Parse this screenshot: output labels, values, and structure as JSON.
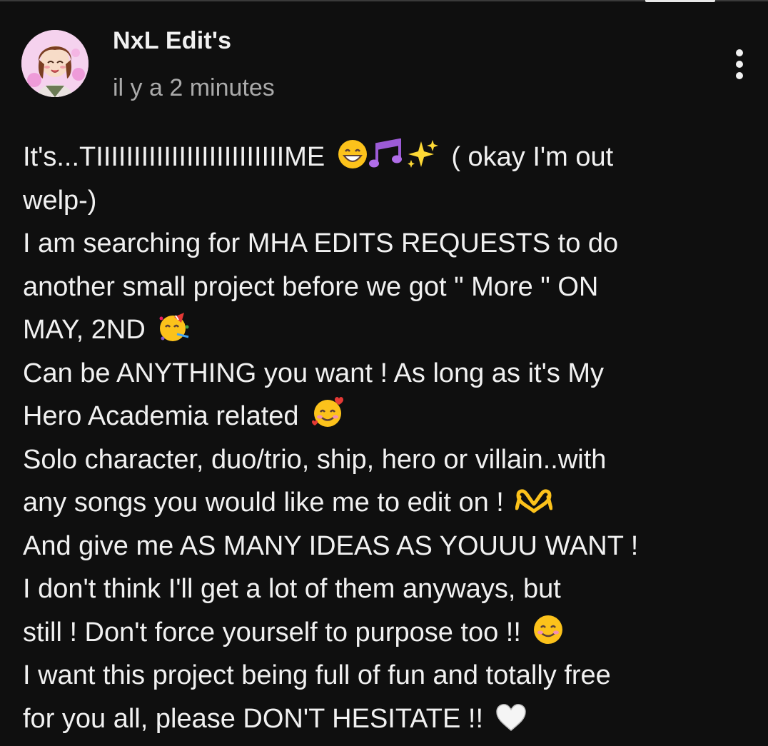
{
  "comment": {
    "author": "NxL Edit's",
    "timestamp": "il y a 2 minutes",
    "more_options_icon": "three-dots-vertical-icon",
    "lines": [
      "It's...TIIIIIIIIIIIIIIIIIIIIIIIIIME",
      "( okay I'm out",
      "welp-)",
      "I am searching for MHA EDITS REQUESTS to do",
      "another small project before we got \" More \" ON",
      "MAY, 2ND",
      "Can be ANYTHING you want ! As long as it's My",
      "Hero Academia related",
      "Solo character, duo/trio, ship, hero or villain..with",
      "any songs you would like me to edit on !",
      "And give me AS MANY IDEAS AS YOUUU WANT !",
      "I don't think I'll get a lot of them anyways, but",
      "still ! Don't force yourself to purpose too !!",
      "I want this project being full of fun and totally free",
      "for you all, please DON'T HESITATE !!"
    ],
    "emojis": [
      "grinning-face-icon",
      "musical-notes-icon",
      "sparkles-icon",
      "partying-face-icon",
      "smiling-face-with-hearts-icon",
      "heart-hands-icon",
      "smiling-face-icon",
      "white-heart-icon"
    ]
  }
}
